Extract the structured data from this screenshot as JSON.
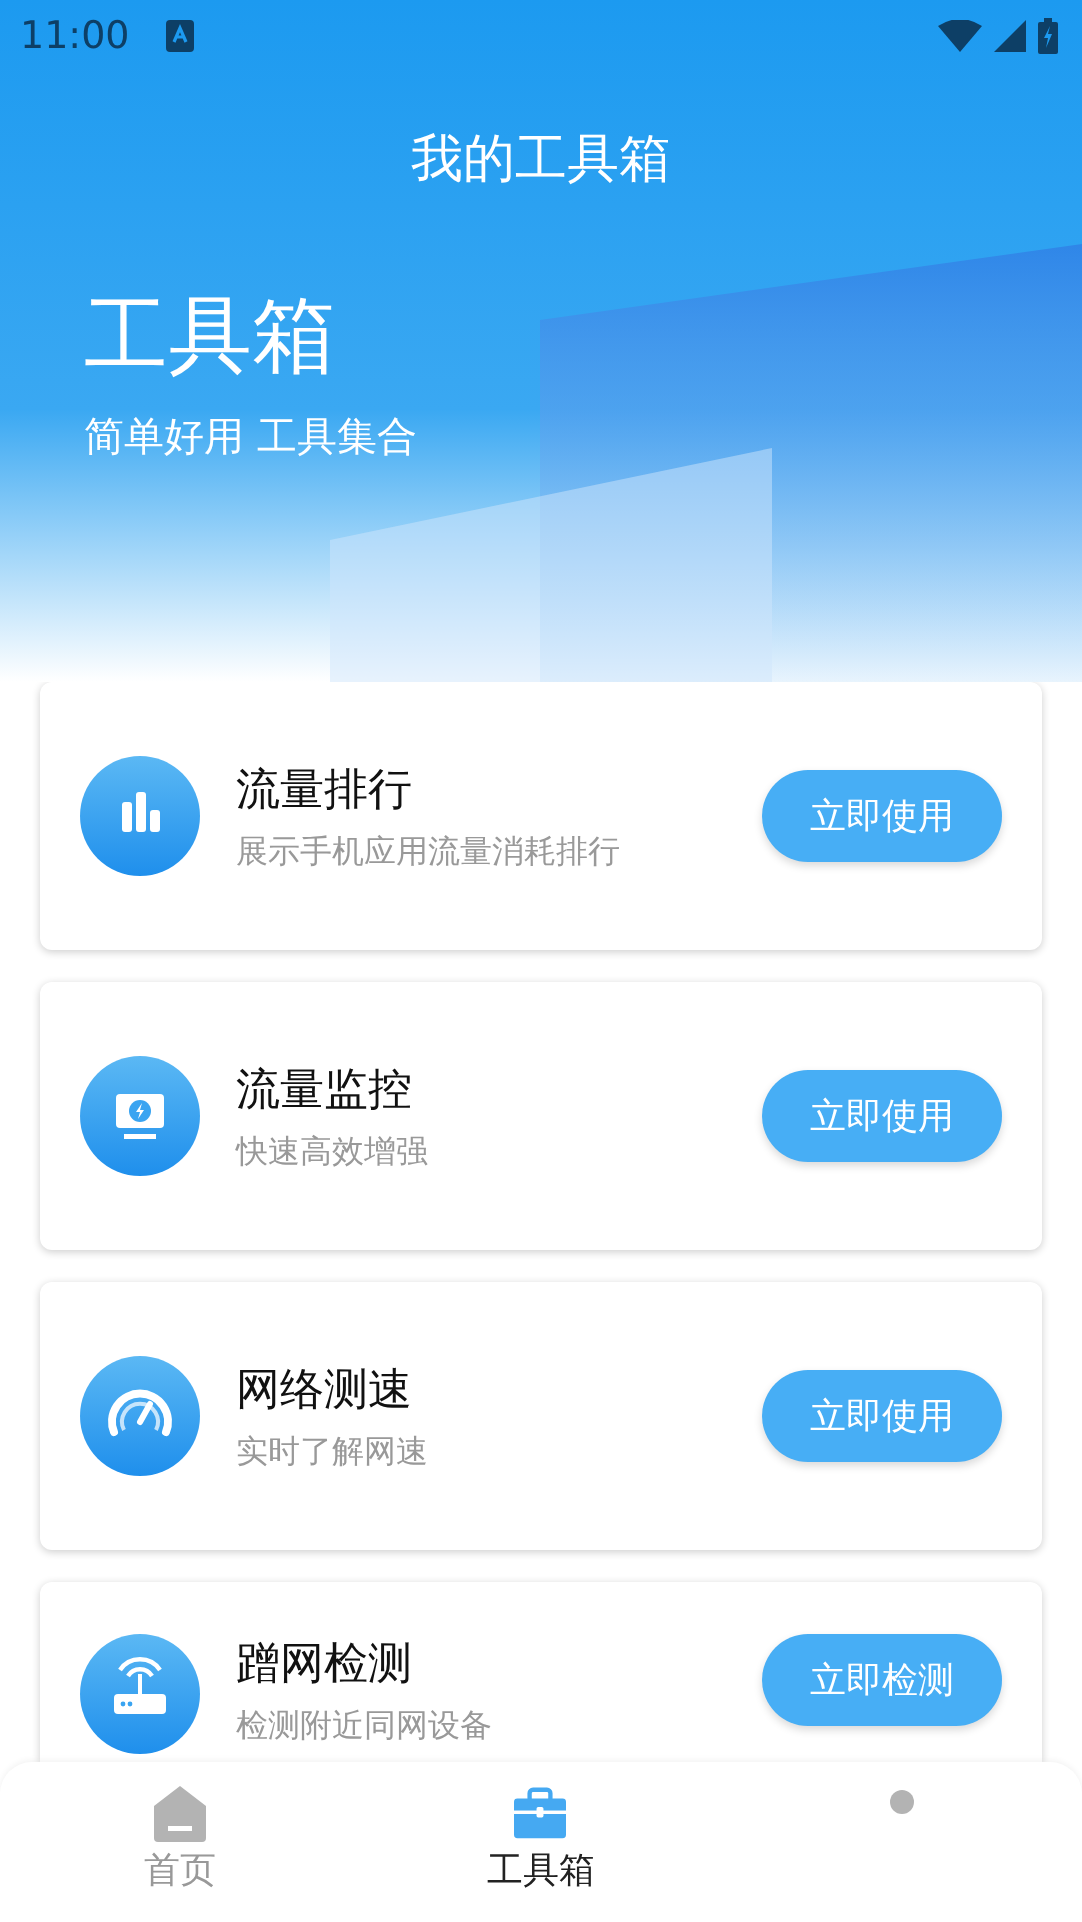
{
  "status_bar": {
    "time": "11:00"
  },
  "header": {
    "title": "我的工具箱",
    "heading": "工具箱",
    "subtitle": "简单好用 工具集合"
  },
  "tools": [
    {
      "kind": "bars",
      "title": "流量排行",
      "description": "展示手机应用流量消耗排行",
      "action": "立即使用"
    },
    {
      "kind": "monitor",
      "title": "流量监控",
      "description": "快速高效增强",
      "action": "立即使用"
    },
    {
      "kind": "gauge",
      "title": "网络测速",
      "description": "实时了解网速",
      "action": "立即使用"
    },
    {
      "kind": "router",
      "title": "蹭网检测",
      "description": "检测附近同网设备",
      "action": "立即检测"
    }
  ],
  "tabs": [
    {
      "kind": "home",
      "label": "首页",
      "selected": false
    },
    {
      "kind": "toolbox",
      "label": "工具箱",
      "selected": true
    },
    {
      "kind": "dot",
      "selected": false
    }
  ]
}
